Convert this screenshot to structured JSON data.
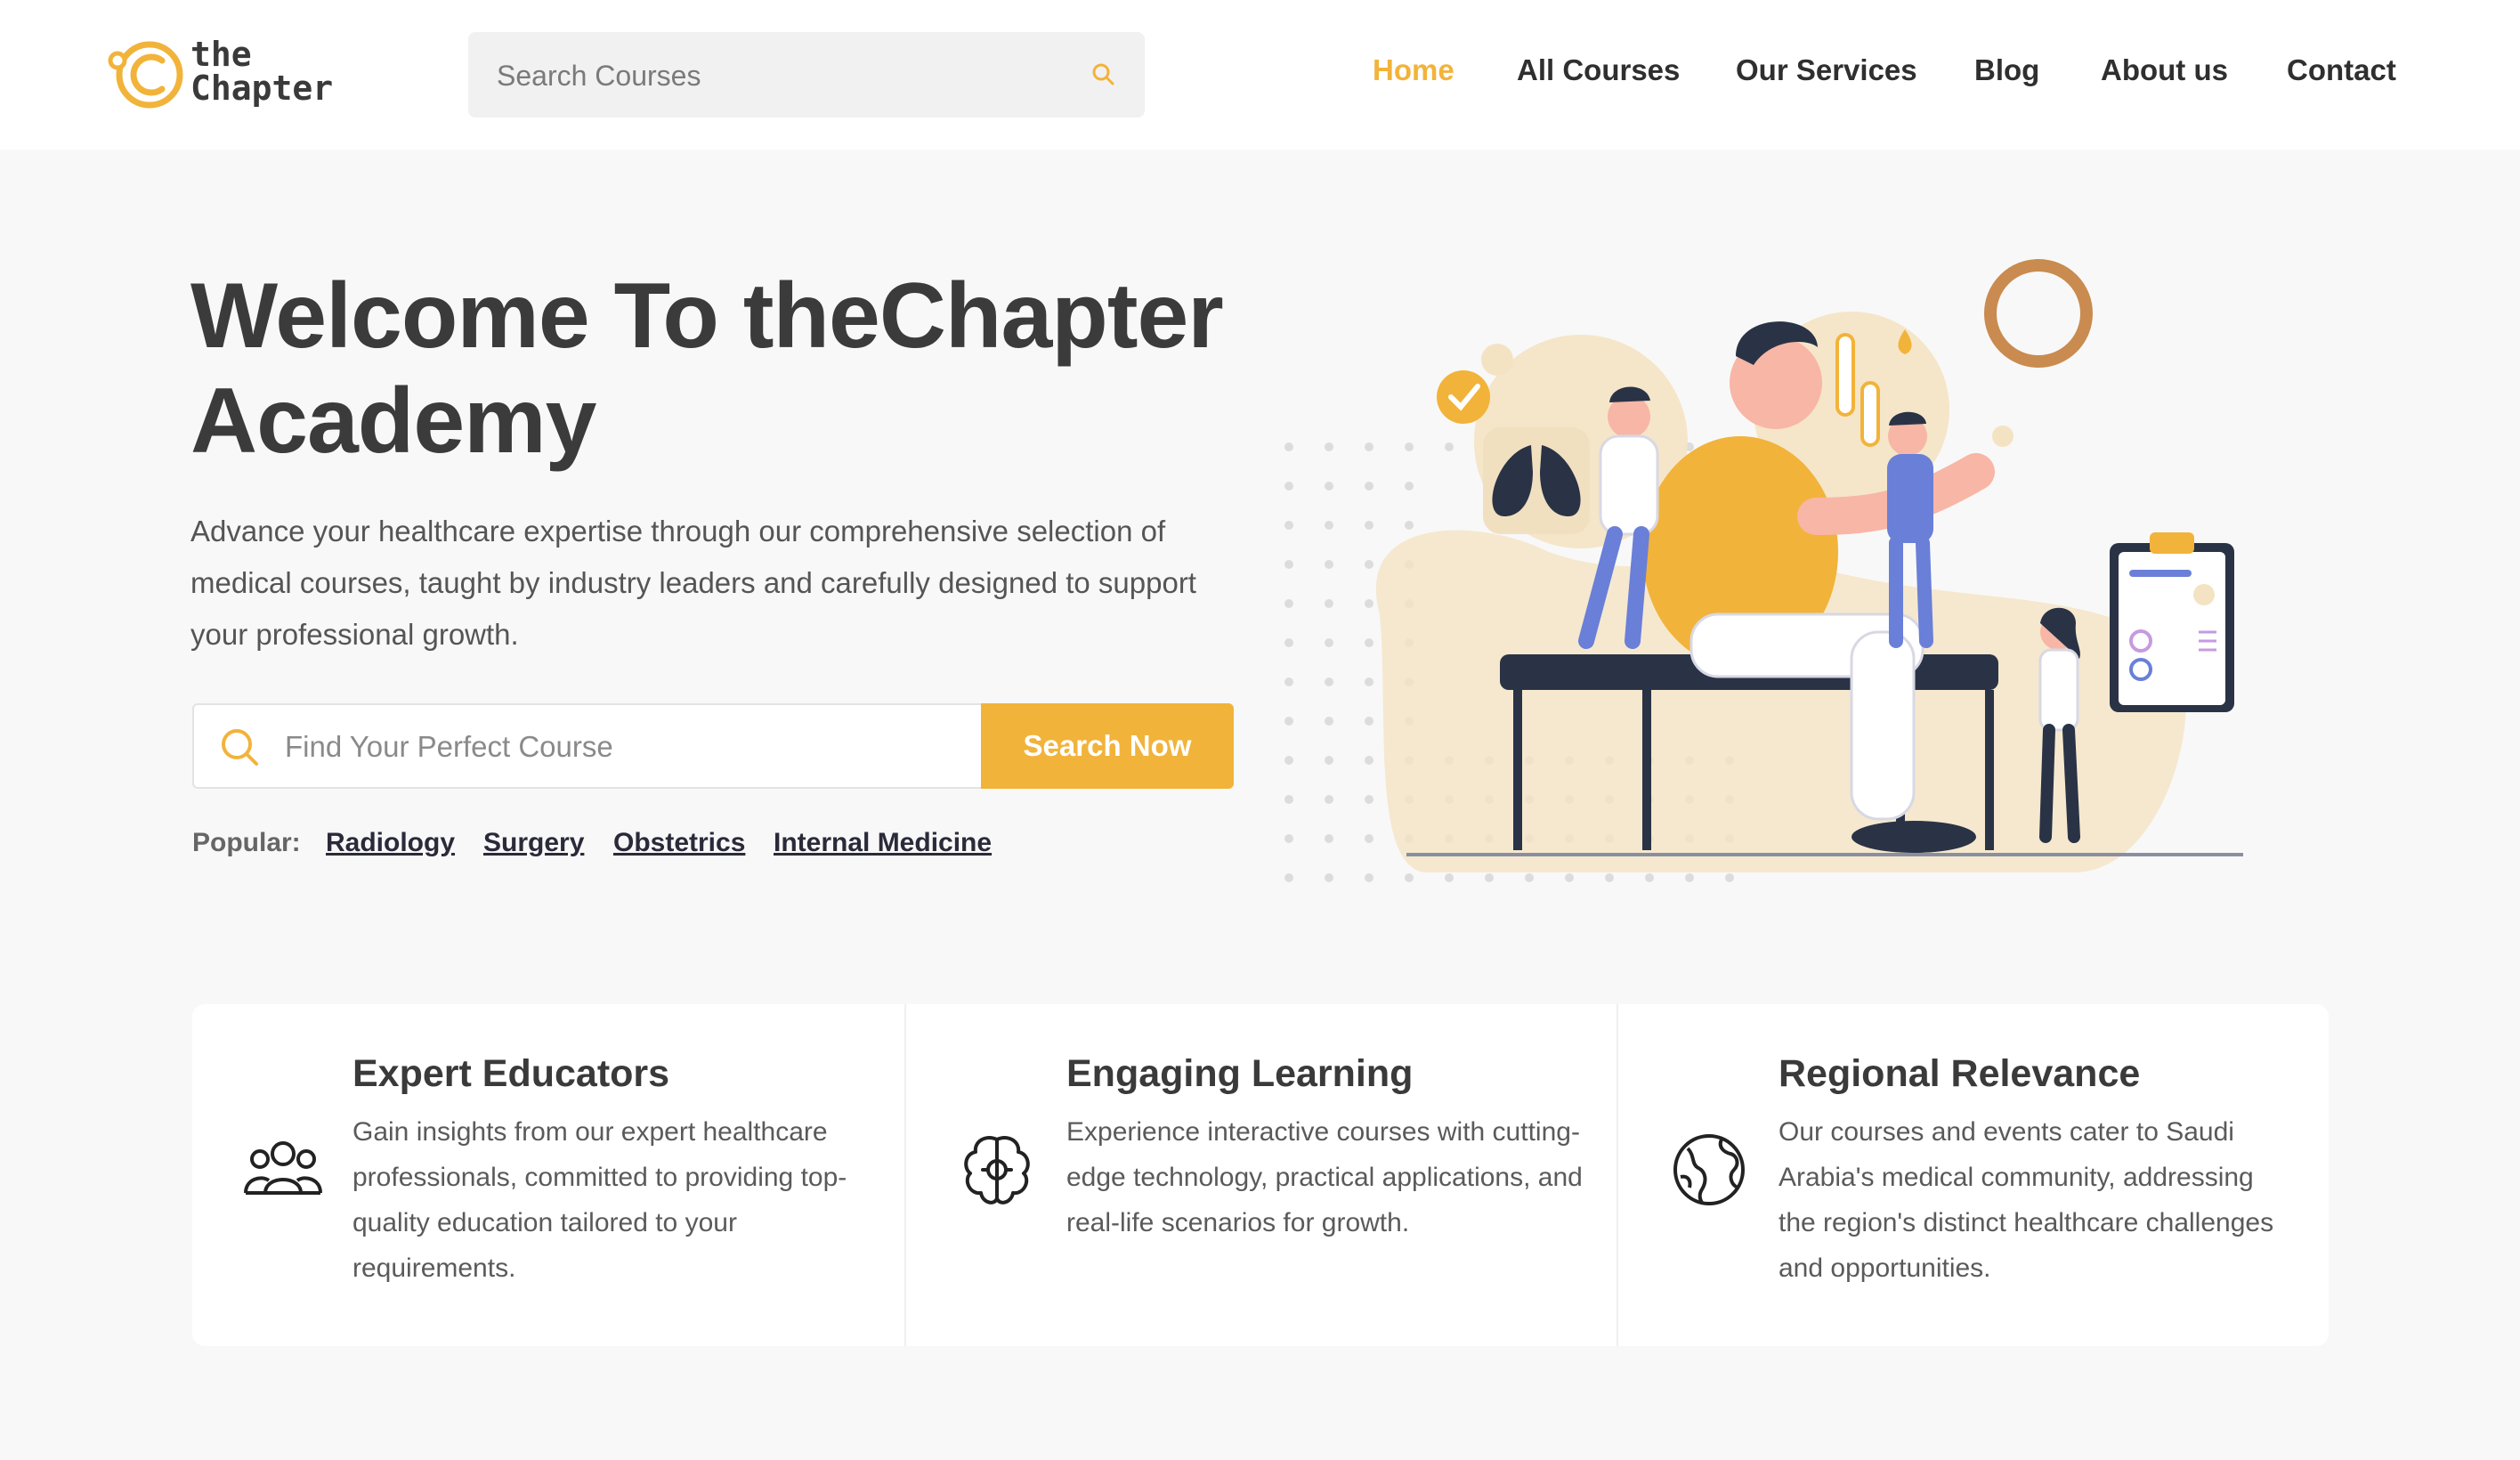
{
  "brand": {
    "line1": "the",
    "line2": "Chapter",
    "accent": "#f2b33a"
  },
  "top_search": {
    "placeholder": "Search Courses",
    "icon": "search-icon"
  },
  "nav": {
    "items": [
      {
        "label": "Home",
        "active": true
      },
      {
        "label": "All Courses"
      },
      {
        "label": "Our Services"
      },
      {
        "label": "Blog"
      },
      {
        "label": "About us"
      },
      {
        "label": "Contact"
      }
    ]
  },
  "hero": {
    "title": "Welcome To theChapter Academy",
    "description": "Advance your healthcare expertise through our comprehensive selection of medical courses, taught by industry leaders and carefully designed to support your professional growth.",
    "search_placeholder": "Find Your Perfect Course",
    "search_button": "Search Now",
    "popular_label": "Popular:",
    "popular_links": [
      "Radiology",
      "Surgery",
      "Obstetrics",
      "Internal Medicine"
    ]
  },
  "features": [
    {
      "icon": "people-group-icon",
      "title": "Expert Educators",
      "text": "Gain insights from our expert healthcare professionals, committed to providing top-quality education tailored to your requirements."
    },
    {
      "icon": "brain-gear-icon",
      "title": "Engaging Learning",
      "text": "Experience interactive courses with cutting-edge technology, practical applications, and real-life scenarios for growth."
    },
    {
      "icon": "globe-icon",
      "title": "Regional Relevance",
      "text": "Our courses and events cater to Saudi Arabia's medical community, addressing the region's distinct healthcare challenges and opportunities."
    }
  ]
}
